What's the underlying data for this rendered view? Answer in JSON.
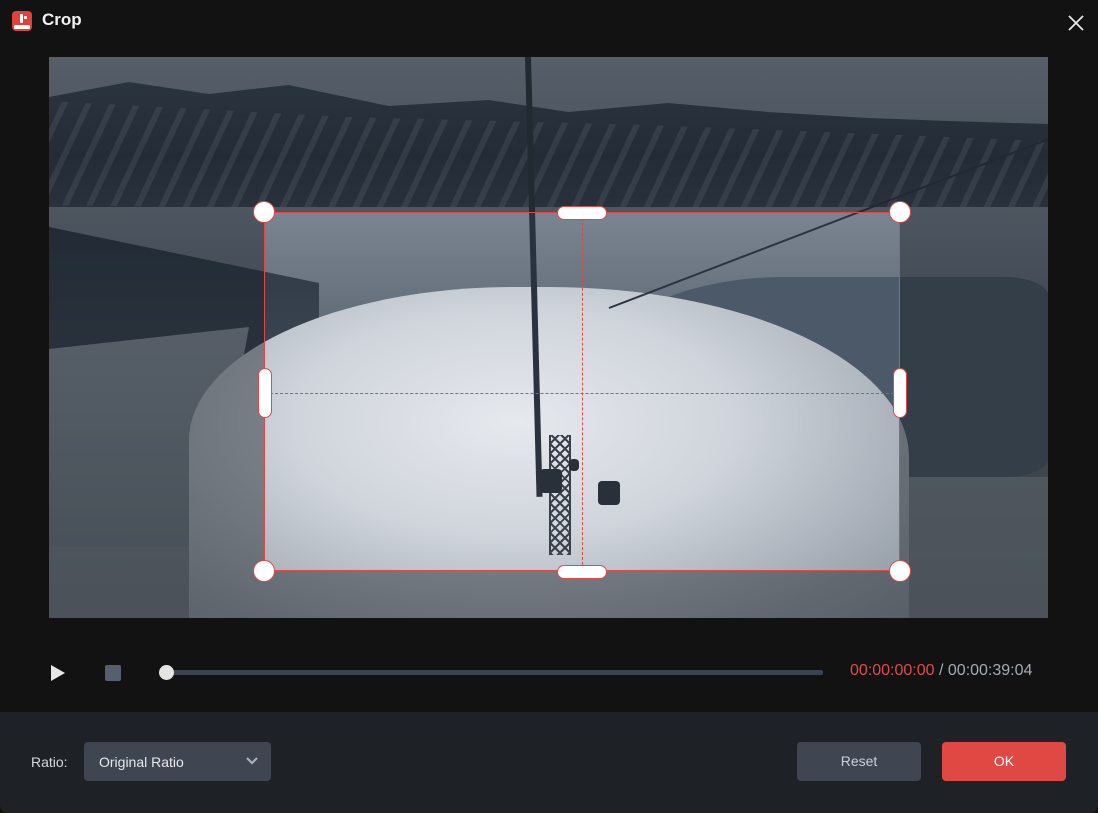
{
  "window": {
    "title": "Crop",
    "app_icon": "app-logo-icon",
    "close_icon": "close-icon"
  },
  "colors": {
    "accent": "#e04848",
    "ok_button": "#e04844",
    "secondary_button": "#3f4652",
    "background": "#121212",
    "panel": "#1e2126",
    "time_current": "#e24b4b",
    "time_total": "#a4abb4"
  },
  "preview": {
    "content": "video frame of snowy mountain valley with ski lift gondolas",
    "crop_guides": "rule of halves (dashed)"
  },
  "playback": {
    "play_icon": "play-icon",
    "stop_icon": "stop-icon",
    "progress_fraction": 0.0,
    "time_current": "00:00:00:00",
    "time_separator": "/",
    "time_total": "00:00:39:04"
  },
  "footer": {
    "ratio_label": "Ratio:",
    "ratio_value": "Original Ratio",
    "ratio_chevron_icon": "chevron-down-icon",
    "reset_label": "Reset",
    "ok_label": "OK"
  }
}
